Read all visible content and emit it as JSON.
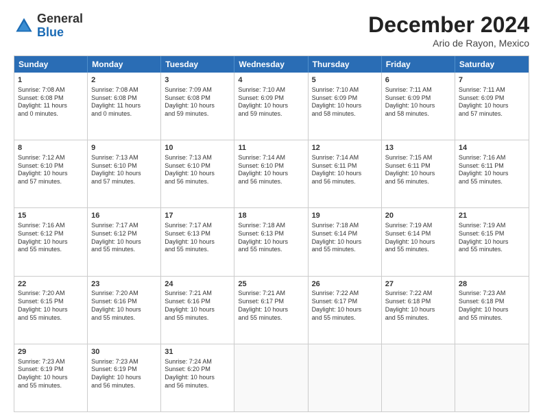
{
  "header": {
    "logo_general": "General",
    "logo_blue": "Blue",
    "main_title": "December 2024",
    "subtitle": "Ario de Rayon, Mexico"
  },
  "days_of_week": [
    "Sunday",
    "Monday",
    "Tuesday",
    "Wednesday",
    "Thursday",
    "Friday",
    "Saturday"
  ],
  "weeks": [
    [
      {
        "day": "1",
        "lines": [
          "Sunrise: 7:08 AM",
          "Sunset: 6:08 PM",
          "Daylight: 11 hours",
          "and 0 minutes."
        ]
      },
      {
        "day": "2",
        "lines": [
          "Sunrise: 7:08 AM",
          "Sunset: 6:08 PM",
          "Daylight: 11 hours",
          "and 0 minutes."
        ]
      },
      {
        "day": "3",
        "lines": [
          "Sunrise: 7:09 AM",
          "Sunset: 6:08 PM",
          "Daylight: 10 hours",
          "and 59 minutes."
        ]
      },
      {
        "day": "4",
        "lines": [
          "Sunrise: 7:10 AM",
          "Sunset: 6:09 PM",
          "Daylight: 10 hours",
          "and 59 minutes."
        ]
      },
      {
        "day": "5",
        "lines": [
          "Sunrise: 7:10 AM",
          "Sunset: 6:09 PM",
          "Daylight: 10 hours",
          "and 58 minutes."
        ]
      },
      {
        "day": "6",
        "lines": [
          "Sunrise: 7:11 AM",
          "Sunset: 6:09 PM",
          "Daylight: 10 hours",
          "and 58 minutes."
        ]
      },
      {
        "day": "7",
        "lines": [
          "Sunrise: 7:11 AM",
          "Sunset: 6:09 PM",
          "Daylight: 10 hours",
          "and 57 minutes."
        ]
      }
    ],
    [
      {
        "day": "8",
        "lines": [
          "Sunrise: 7:12 AM",
          "Sunset: 6:10 PM",
          "Daylight: 10 hours",
          "and 57 minutes."
        ]
      },
      {
        "day": "9",
        "lines": [
          "Sunrise: 7:13 AM",
          "Sunset: 6:10 PM",
          "Daylight: 10 hours",
          "and 57 minutes."
        ]
      },
      {
        "day": "10",
        "lines": [
          "Sunrise: 7:13 AM",
          "Sunset: 6:10 PM",
          "Daylight: 10 hours",
          "and 56 minutes."
        ]
      },
      {
        "day": "11",
        "lines": [
          "Sunrise: 7:14 AM",
          "Sunset: 6:10 PM",
          "Daylight: 10 hours",
          "and 56 minutes."
        ]
      },
      {
        "day": "12",
        "lines": [
          "Sunrise: 7:14 AM",
          "Sunset: 6:11 PM",
          "Daylight: 10 hours",
          "and 56 minutes."
        ]
      },
      {
        "day": "13",
        "lines": [
          "Sunrise: 7:15 AM",
          "Sunset: 6:11 PM",
          "Daylight: 10 hours",
          "and 56 minutes."
        ]
      },
      {
        "day": "14",
        "lines": [
          "Sunrise: 7:16 AM",
          "Sunset: 6:11 PM",
          "Daylight: 10 hours",
          "and 55 minutes."
        ]
      }
    ],
    [
      {
        "day": "15",
        "lines": [
          "Sunrise: 7:16 AM",
          "Sunset: 6:12 PM",
          "Daylight: 10 hours",
          "and 55 minutes."
        ]
      },
      {
        "day": "16",
        "lines": [
          "Sunrise: 7:17 AM",
          "Sunset: 6:12 PM",
          "Daylight: 10 hours",
          "and 55 minutes."
        ]
      },
      {
        "day": "17",
        "lines": [
          "Sunrise: 7:17 AM",
          "Sunset: 6:13 PM",
          "Daylight: 10 hours",
          "and 55 minutes."
        ]
      },
      {
        "day": "18",
        "lines": [
          "Sunrise: 7:18 AM",
          "Sunset: 6:13 PM",
          "Daylight: 10 hours",
          "and 55 minutes."
        ]
      },
      {
        "day": "19",
        "lines": [
          "Sunrise: 7:18 AM",
          "Sunset: 6:14 PM",
          "Daylight: 10 hours",
          "and 55 minutes."
        ]
      },
      {
        "day": "20",
        "lines": [
          "Sunrise: 7:19 AM",
          "Sunset: 6:14 PM",
          "Daylight: 10 hours",
          "and 55 minutes."
        ]
      },
      {
        "day": "21",
        "lines": [
          "Sunrise: 7:19 AM",
          "Sunset: 6:15 PM",
          "Daylight: 10 hours",
          "and 55 minutes."
        ]
      }
    ],
    [
      {
        "day": "22",
        "lines": [
          "Sunrise: 7:20 AM",
          "Sunset: 6:15 PM",
          "Daylight: 10 hours",
          "and 55 minutes."
        ]
      },
      {
        "day": "23",
        "lines": [
          "Sunrise: 7:20 AM",
          "Sunset: 6:16 PM",
          "Daylight: 10 hours",
          "and 55 minutes."
        ]
      },
      {
        "day": "24",
        "lines": [
          "Sunrise: 7:21 AM",
          "Sunset: 6:16 PM",
          "Daylight: 10 hours",
          "and 55 minutes."
        ]
      },
      {
        "day": "25",
        "lines": [
          "Sunrise: 7:21 AM",
          "Sunset: 6:17 PM",
          "Daylight: 10 hours",
          "and 55 minutes."
        ]
      },
      {
        "day": "26",
        "lines": [
          "Sunrise: 7:22 AM",
          "Sunset: 6:17 PM",
          "Daylight: 10 hours",
          "and 55 minutes."
        ]
      },
      {
        "day": "27",
        "lines": [
          "Sunrise: 7:22 AM",
          "Sunset: 6:18 PM",
          "Daylight: 10 hours",
          "and 55 minutes."
        ]
      },
      {
        "day": "28",
        "lines": [
          "Sunrise: 7:23 AM",
          "Sunset: 6:18 PM",
          "Daylight: 10 hours",
          "and 55 minutes."
        ]
      }
    ],
    [
      {
        "day": "29",
        "lines": [
          "Sunrise: 7:23 AM",
          "Sunset: 6:19 PM",
          "Daylight: 10 hours",
          "and 55 minutes."
        ]
      },
      {
        "day": "30",
        "lines": [
          "Sunrise: 7:23 AM",
          "Sunset: 6:19 PM",
          "Daylight: 10 hours",
          "and 56 minutes."
        ]
      },
      {
        "day": "31",
        "lines": [
          "Sunrise: 7:24 AM",
          "Sunset: 6:20 PM",
          "Daylight: 10 hours",
          "and 56 minutes."
        ]
      },
      {
        "day": "",
        "lines": []
      },
      {
        "day": "",
        "lines": []
      },
      {
        "day": "",
        "lines": []
      },
      {
        "day": "",
        "lines": []
      }
    ]
  ]
}
